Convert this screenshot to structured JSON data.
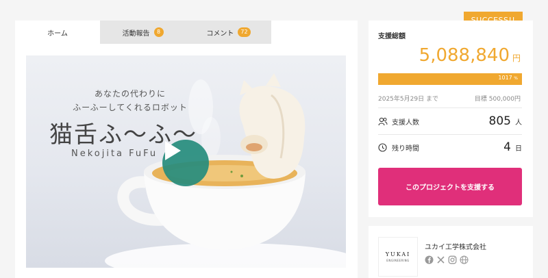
{
  "tabs": [
    {
      "label": "ホーム"
    },
    {
      "label": "活動報告",
      "badge": "8"
    },
    {
      "label": "コメント",
      "badge": "72"
    }
  ],
  "hero": {
    "subtitle_line1": "あなたの代わりに",
    "subtitle_line2": "ふーふーしてくれるロボット",
    "title": "猫舌ふ〜ふ〜",
    "title_roman": "Nekojita FuFu"
  },
  "status_badge": "SUCCESS!!",
  "funding": {
    "label": "支援総額",
    "amount": "5,088,840",
    "currency": "円",
    "percent": "1017",
    "percent_unit": "%",
    "end_date": "2025年5月29日 まで",
    "target": "目標 500,000円"
  },
  "stats": {
    "supporters_label": "支援人数",
    "supporters_value": "805",
    "supporters_unit": "人",
    "remaining_label": "残り時間",
    "remaining_value": "4",
    "remaining_unit": "日"
  },
  "support_button": "このプロジェクトを支援する",
  "company": {
    "name": "ユカイ工学株式会社",
    "logo_text": "YUKAI",
    "logo_sub": "ENGINEERING",
    "social_icons": [
      "facebook-icon",
      "x-icon",
      "instagram-icon",
      "web-icon"
    ]
  },
  "colors": {
    "accent": "#f0a830",
    "support_button": "#e02f7a",
    "play_button": "#268c7d"
  }
}
